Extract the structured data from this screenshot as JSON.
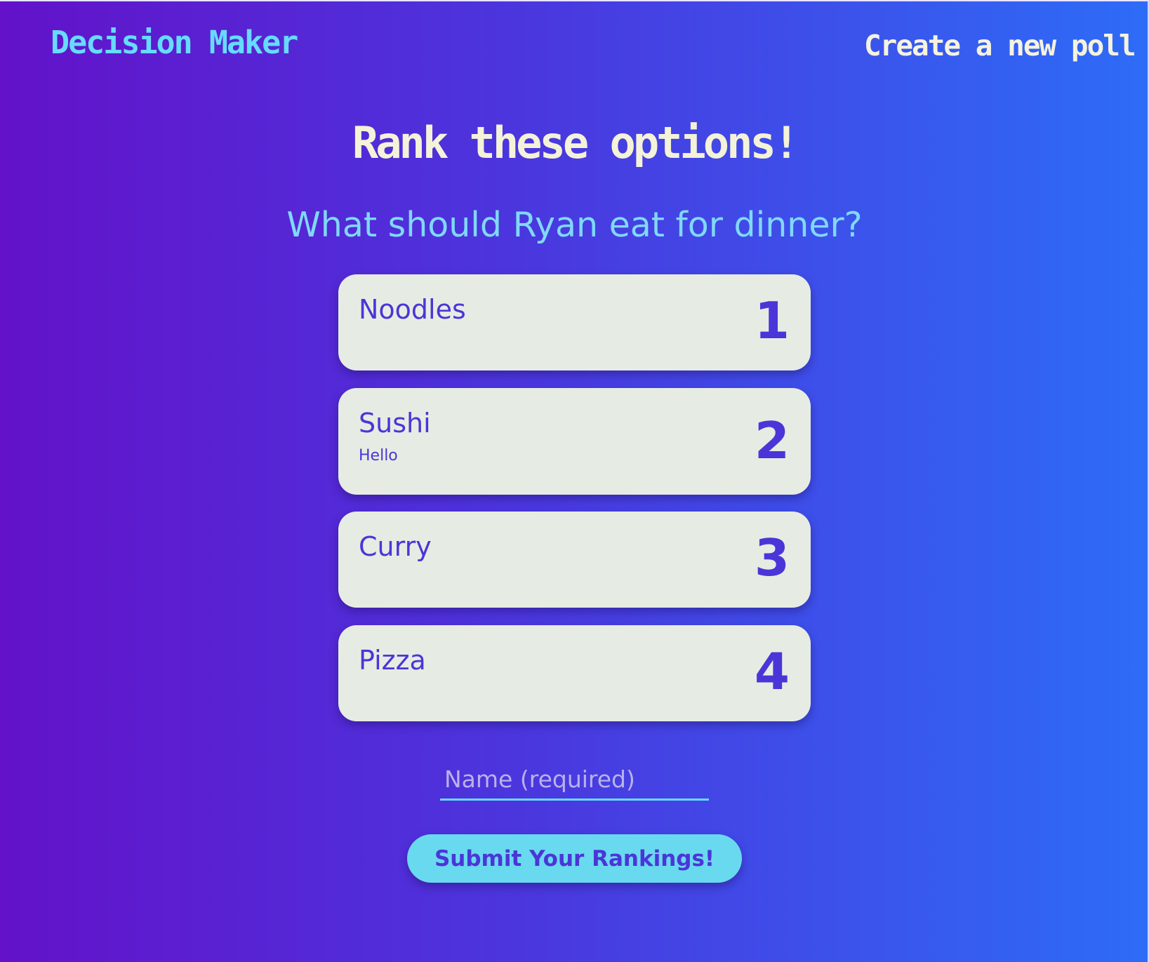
{
  "header": {
    "brand": "Decision Maker",
    "new_poll_link": "Create a new poll"
  },
  "main": {
    "heading": "Rank these options!",
    "question": "What should Ryan eat for dinner?",
    "options": [
      {
        "title": "Noodles",
        "description": "",
        "rank": "1"
      },
      {
        "title": "Sushi",
        "description": "Hello",
        "rank": "2"
      },
      {
        "title": "Curry",
        "description": "",
        "rank": "3"
      },
      {
        "title": "Pizza",
        "description": "",
        "rank": "4"
      }
    ],
    "name_input": {
      "value": "",
      "placeholder": "Name (required)"
    },
    "submit_label": "Submit Your Rankings!"
  },
  "colors": {
    "gradient_start": "#6312c9",
    "gradient_end": "#2d6cf7",
    "brand": "#66dbff",
    "card": "#e6ece3",
    "card_text": "#4a36d8",
    "button": "#69d9ef",
    "heading": "#f4f2d8"
  }
}
